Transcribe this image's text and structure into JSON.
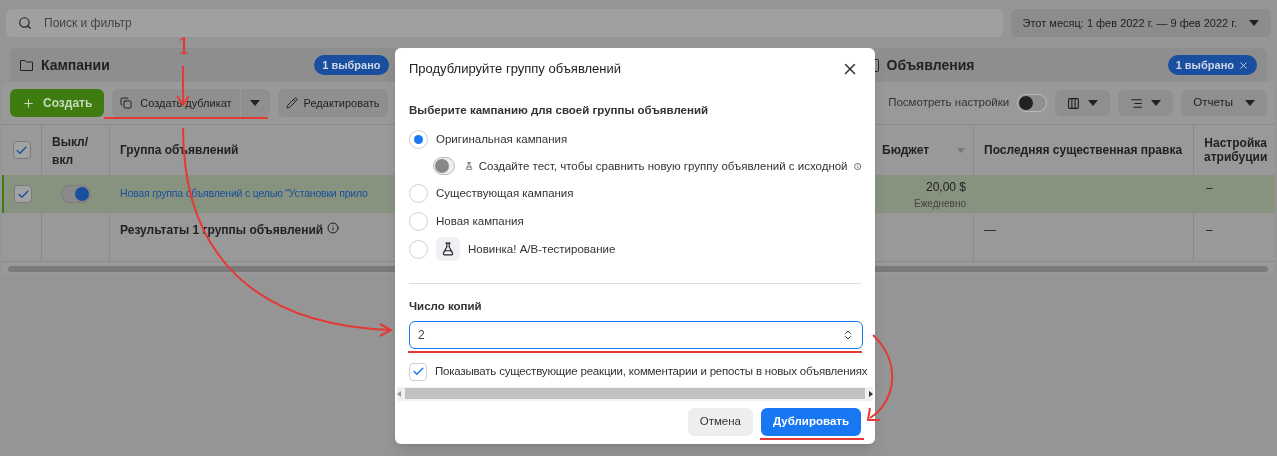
{
  "search": {
    "placeholder": "Поиск и фильтр"
  },
  "date_range": {
    "label": "Этот месяц: 1 фев 2022 г. — 9 фев 2022 г."
  },
  "levels": [
    {
      "title": "Кампании",
      "badge": "1 выбрано",
      "closable": false
    },
    {
      "title": "Объявления",
      "badge": "1 выбрано",
      "closable": true
    }
  ],
  "toolbar": {
    "create": "Создать",
    "duplicate": "Создать дубликат",
    "edit": "Редактировать",
    "view_settings": {
      "label": "Посмотреть настройки",
      "on": false
    },
    "reports": "Отчеты"
  },
  "table": {
    "all_checked": true,
    "columns": {
      "toggle": "Выкл/ вкл",
      "name": "Группа объявлений",
      "budget": "Бюджет",
      "last_edit": "Последняя существенная правка",
      "attribution": "Настройка атрибуции"
    },
    "rows": [
      {
        "checked": true,
        "on": true,
        "name": "Новая группа объявлений с целью \"Установки прило",
        "budget": "20,00 $",
        "budget_period": "Ежедневно",
        "attribution": "–"
      }
    ],
    "summary": {
      "label": "Результаты 1 группы объявлений",
      "last_edit": "—",
      "attribution": "–"
    }
  },
  "dialog": {
    "title": "Продублируйте группу объявлений",
    "section_label": "Выберите кампанию для своей группы объявлений",
    "options": [
      {
        "kind": "plain",
        "label": "Оригинальная кампания",
        "selected": true,
        "sub": {
          "label": "Создайте тест, чтобы сравнить новую группу объявлений с исходной",
          "on": false
        }
      },
      {
        "kind": "plain",
        "label": "Существующая кампания",
        "selected": false
      },
      {
        "kind": "plain",
        "label": "Новая кампания",
        "selected": false
      },
      {
        "kind": "ab_test",
        "label": "Новинка! A/B-тестирование",
        "selected": false
      }
    ],
    "copies": {
      "label": "Число копий",
      "value": "2"
    },
    "show_reactions": {
      "label": "Показывать существующие реакции, комментарии и репосты в новых объявлениях",
      "checked": true
    },
    "cancel": "Отмена",
    "confirm": "Дублировать"
  },
  "annotation": {
    "step": "1"
  }
}
